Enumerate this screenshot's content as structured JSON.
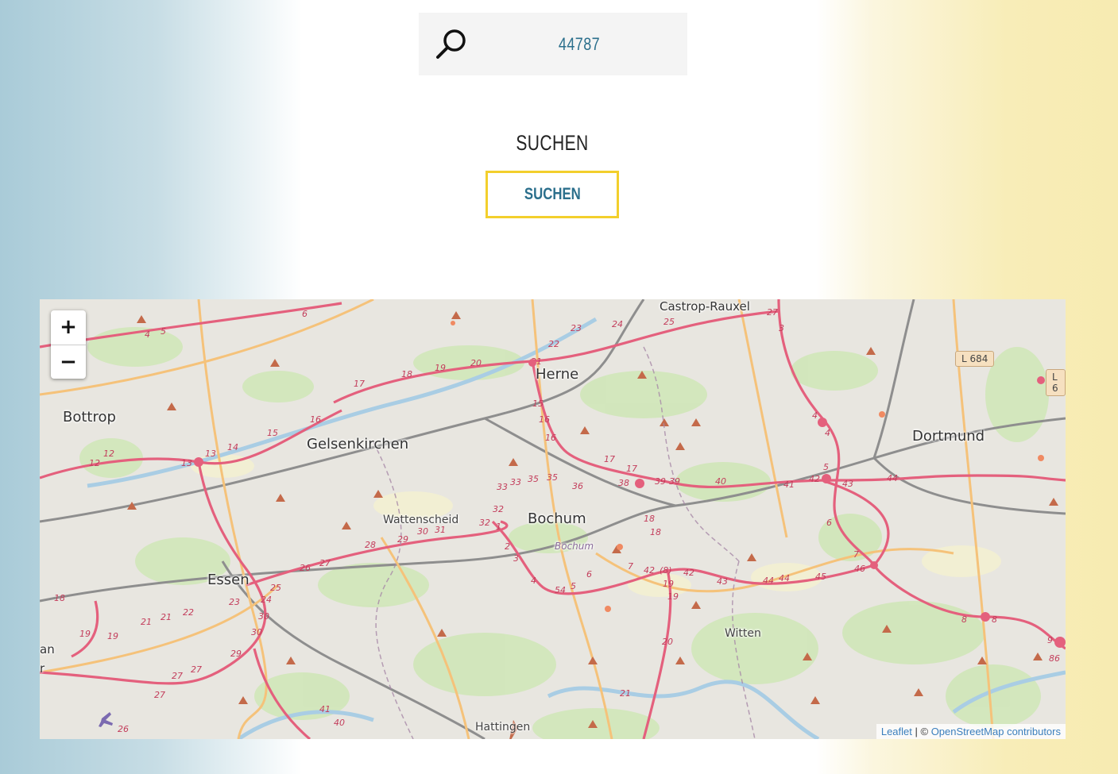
{
  "search": {
    "value": "44787",
    "icon": "search-icon"
  },
  "heading": "SUCHEN",
  "submit_label": "SUCHEN",
  "colors": {
    "accent_text": "#2b6f8c",
    "button_border": "#f3cf2c",
    "left_gradient": "#a9cbd8",
    "right_gradient": "#f7ebb1"
  },
  "map": {
    "zoom_in": "+",
    "zoom_out": "−",
    "attribution_leaflet": "Leaflet",
    "attribution_separator": " | © ",
    "attribution_osm": "OpenStreetMap contributors",
    "places": {
      "castrop_rauxel": "Castrop-Rauxel",
      "herne": "Herne",
      "bottrop": "Bottrop",
      "gelsenkirchen": "Gelsenkirchen",
      "dortmund": "Dortmund",
      "wattenscheid": "Wattenscheid",
      "bochum": "Bochum",
      "bochum_district": "Bochum",
      "essen": "Essen",
      "witten": "Witten",
      "hattingen": "Hattingen",
      "edge_an": "an",
      "edge_r": "r"
    },
    "road_badges": {
      "l684": "L 684",
      "l6": "L 6"
    }
  }
}
